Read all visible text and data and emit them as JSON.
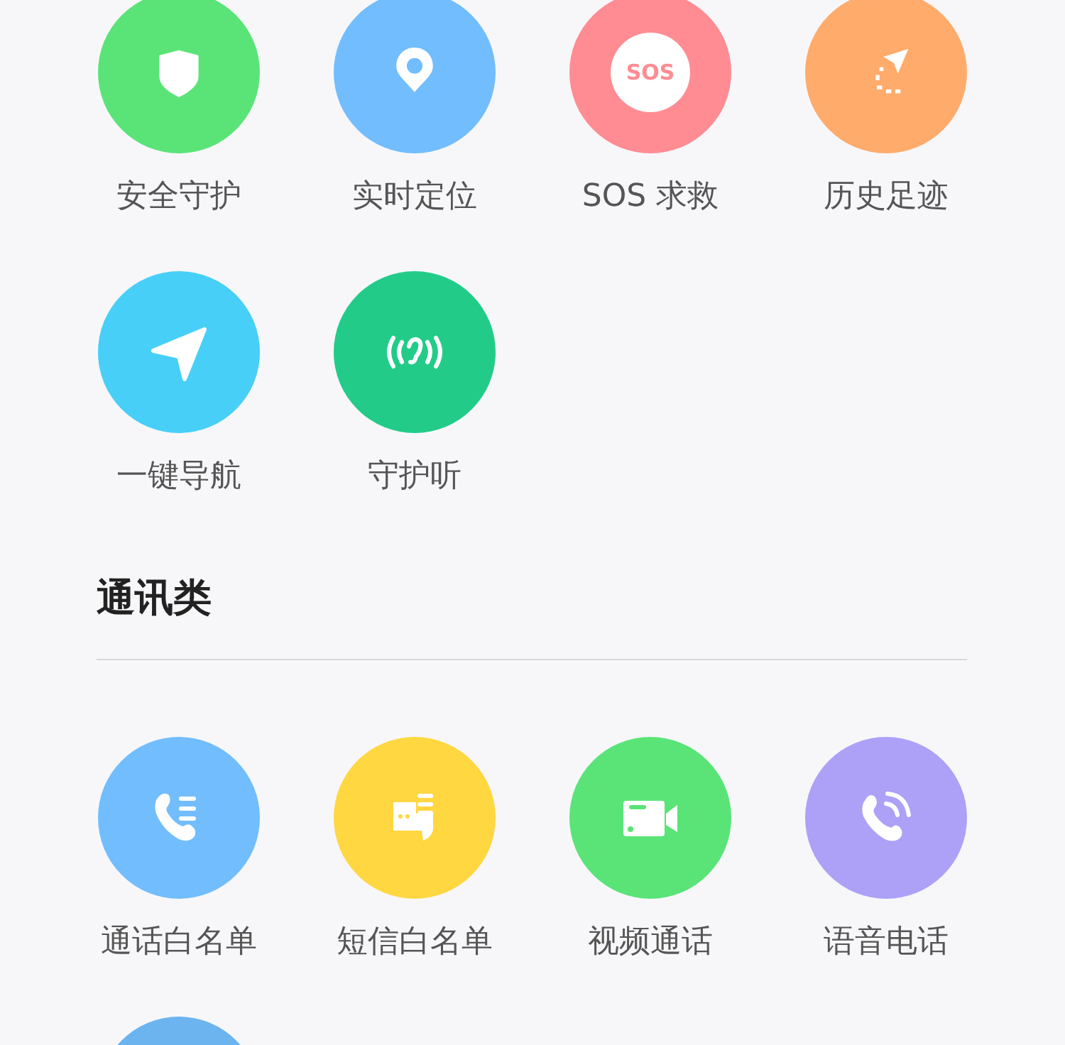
{
  "sections": [
    {
      "items": [
        {
          "label": "安全守护",
          "kind": "shield",
          "color": "#5ae477"
        },
        {
          "label": "实时定位",
          "kind": "pin",
          "color": "#72bdfd"
        },
        {
          "label": "SOS 求救",
          "kind": "sos",
          "color": "#ff8c93",
          "badge": "SOS"
        },
        {
          "label": "历史足迹",
          "kind": "track",
          "color": "#ffab6c"
        },
        {
          "label": "一键导航",
          "kind": "navigate",
          "color": "#47cff7"
        },
        {
          "label": "守护听",
          "kind": "listen",
          "color": "#22cc88"
        }
      ]
    },
    {
      "title": "通讯类",
      "items": [
        {
          "label": "通话白名单",
          "kind": "call-list",
          "color": "#72bdfd"
        },
        {
          "label": "短信白名单",
          "kind": "sms-list",
          "color": "#ffd740"
        },
        {
          "label": "视频通话",
          "kind": "video",
          "color": "#5ae477"
        },
        {
          "label": "语音电话",
          "kind": "voice",
          "color": "#aca1f7"
        },
        {
          "color": "#6cb4f0"
        }
      ]
    }
  ]
}
